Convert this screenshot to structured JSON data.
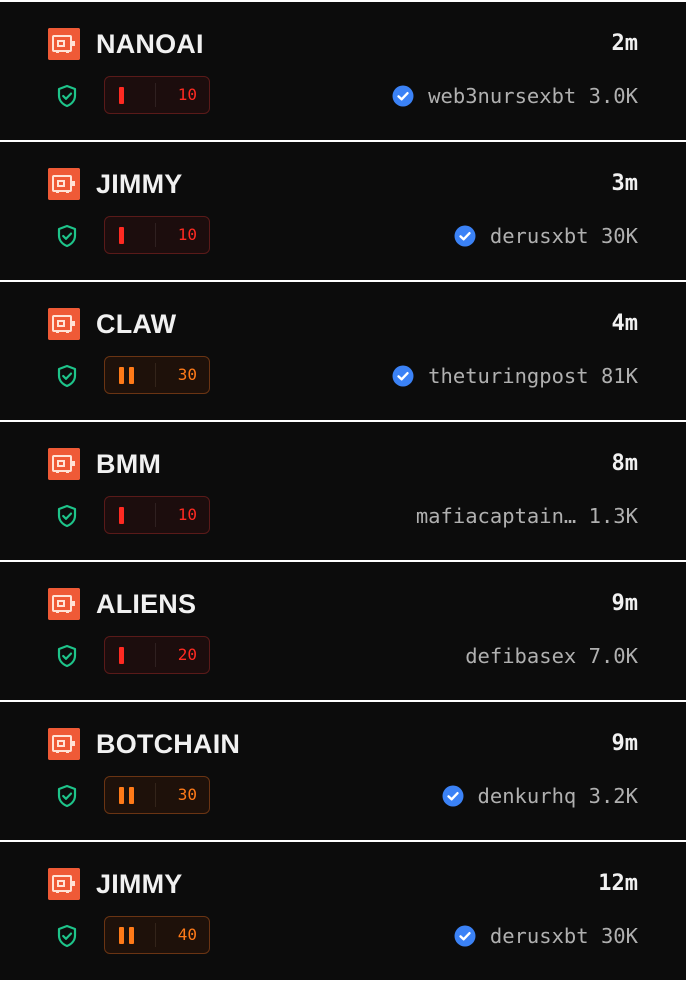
{
  "colors": {
    "row_background": "#0c0c0c",
    "separator": "#ffffff",
    "logo_orange": "#ef5a36",
    "shield_green": "#1ec48a",
    "risk_red": "#ff2a22",
    "risk_orange": "#ff7a18",
    "verified_blue": "#3b82f6",
    "text_primary": "#f1f1f1",
    "text_secondary": "#b0b0b0"
  },
  "rows": [
    {
      "name": "NANOAI",
      "time": "2m",
      "level": 1,
      "score": "10",
      "tone": "red",
      "verified": true,
      "handle": "web3nursexbt",
      "followers": "3.0K"
    },
    {
      "name": "JIMMY",
      "time": "3m",
      "level": 1,
      "score": "10",
      "tone": "red",
      "verified": true,
      "handle": "derusxbt",
      "followers": "30K"
    },
    {
      "name": "CLAW",
      "time": "4m",
      "level": 2,
      "score": "30",
      "tone": "orange",
      "verified": true,
      "handle": "theturingpost",
      "followers": "81K"
    },
    {
      "name": "BMM",
      "time": "8m",
      "level": 1,
      "score": "10",
      "tone": "red",
      "verified": false,
      "handle": "mafiacaptain…",
      "followers": "1.3K"
    },
    {
      "name": "ALIENS",
      "time": "9m",
      "level": 1,
      "score": "20",
      "tone": "red",
      "verified": false,
      "handle": "defibasex",
      "followers": "7.0K"
    },
    {
      "name": "BOTCHAIN",
      "time": "9m",
      "level": 2,
      "score": "30",
      "tone": "orange",
      "verified": true,
      "handle": "denkurhq",
      "followers": "3.2K"
    },
    {
      "name": "JIMMY",
      "time": "12m",
      "level": 2,
      "score": "40",
      "tone": "orange",
      "verified": true,
      "handle": "derusxbt",
      "followers": "30K"
    }
  ]
}
